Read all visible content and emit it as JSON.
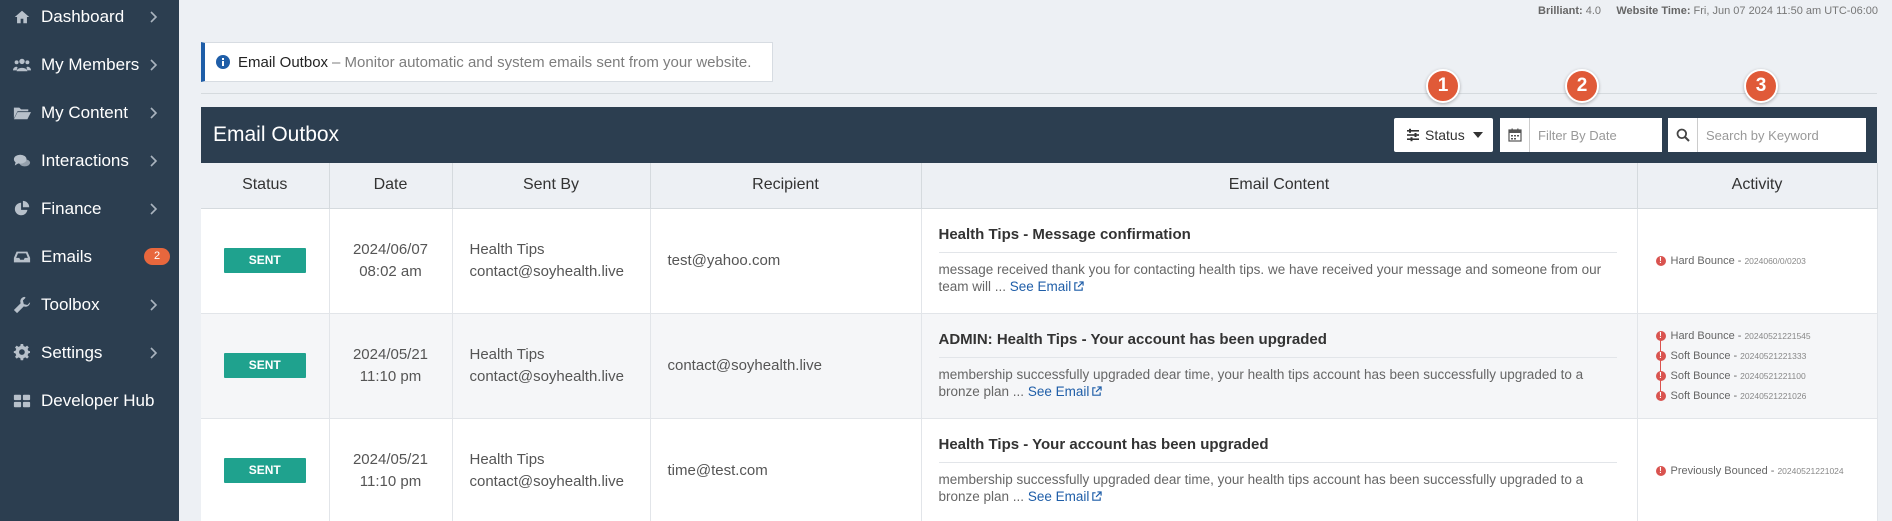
{
  "sidebar": {
    "items": [
      {
        "label": "Dashboard",
        "icon": "home-icon"
      },
      {
        "label": "My Members",
        "icon": "users-icon"
      },
      {
        "label": "My Content",
        "icon": "folder-icon"
      },
      {
        "label": "Interactions",
        "icon": "comments-icon"
      },
      {
        "label": "Finance",
        "icon": "pie-chart-icon"
      },
      {
        "label": "Emails",
        "icon": "inbox-icon",
        "badge": "2"
      },
      {
        "label": "Toolbox",
        "icon": "wrench-icon"
      },
      {
        "label": "Settings",
        "icon": "gear-icon"
      },
      {
        "label": "Developer Hub",
        "icon": "grid-icon"
      }
    ]
  },
  "topbar": {
    "brilliant_label": "Brilliant:",
    "brilliant_value": "4.0",
    "time_label": "Website Time:",
    "time_value": "Fri, Jun 07 2024 11:50 am UTC-06:00"
  },
  "info": {
    "title": "Email Outbox",
    "subtitle": "– Monitor automatic and system emails sent from your website."
  },
  "markers": [
    "1",
    "2",
    "3"
  ],
  "panel": {
    "title": "Email Outbox",
    "status_label": "Status",
    "date_placeholder": "Filter By Date",
    "search_placeholder": "Search by Keyword"
  },
  "table": {
    "columns": [
      "Status",
      "Date",
      "Sent By",
      "Recipient",
      "Email Content",
      "Activity"
    ],
    "rows": [
      {
        "status": "SENT",
        "date": "2024/06/07",
        "time": "08:02 am",
        "sender_name": "Health Tips",
        "sender_email": "contact@soyhealth.live",
        "recipient": "test@yahoo.com",
        "subject": "Health Tips - Message confirmation",
        "snippet": "message received thank you for contacting health tips. we have received your message and someone from our team will ... ",
        "see_email": "See Email",
        "activity": [
          {
            "label": "Hard Bounce -",
            "stamp": "2024060/0/0203"
          }
        ]
      },
      {
        "status": "SENT",
        "date": "2024/05/21",
        "time": "11:10 pm",
        "sender_name": "Health Tips",
        "sender_email": "contact@soyhealth.live",
        "recipient": "contact@soyhealth.live",
        "subject": "ADMIN: Health Tips - Your account has been upgraded",
        "snippet": "membership successfully upgraded dear time, your health tips account has been successfully upgraded to a bronze plan ... ",
        "see_email": "See Email",
        "activity": [
          {
            "label": "Hard Bounce -",
            "stamp": "20240521221545"
          },
          {
            "label": "Soft Bounce -",
            "stamp": "20240521221333"
          },
          {
            "label": "Soft Bounce -",
            "stamp": "20240521221100"
          },
          {
            "label": "Soft Bounce -",
            "stamp": "20240521221026"
          }
        ]
      },
      {
        "status": "SENT",
        "date": "2024/05/21",
        "time": "11:10 pm",
        "sender_name": "Health Tips",
        "sender_email": "contact@soyhealth.live",
        "recipient": "time@test.com",
        "subject": "Health Tips - Your account has been upgraded",
        "snippet": "membership successfully upgraded dear time, your health tips account has been successfully upgraded to a bronze plan ... ",
        "see_email": "See Email",
        "activity": [
          {
            "label": "Previously Bounced -",
            "stamp": "20240521221024"
          }
        ]
      }
    ]
  },
  "colors": {
    "sidebar_bg": "#2c3e50",
    "accent_blue": "#1f5ea8",
    "sent_green": "#1fa28e",
    "marker_orange": "#e05a38",
    "bounce_red": "#d9534f"
  }
}
